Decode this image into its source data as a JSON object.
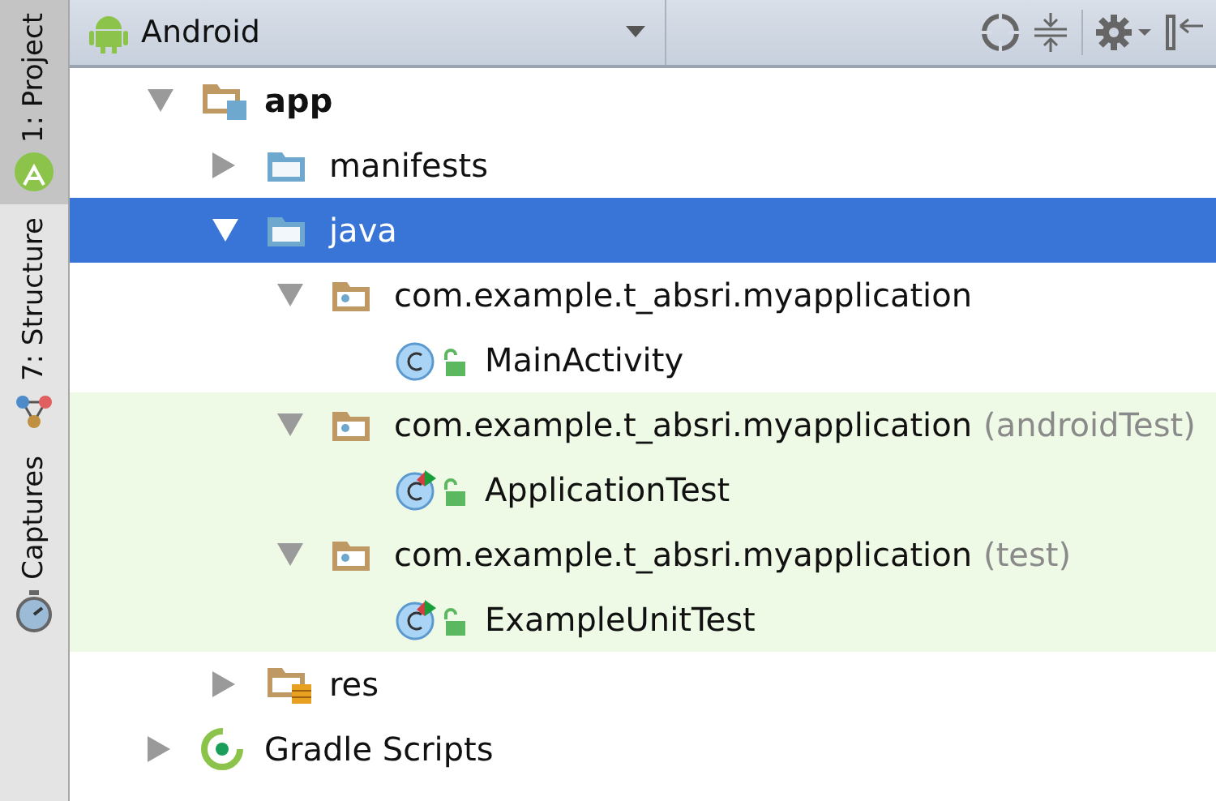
{
  "side_tabs": [
    {
      "label": "1: Project",
      "kind": "android",
      "selected": true
    },
    {
      "label": "7: Structure",
      "kind": "structure",
      "selected": false
    },
    {
      "label": "Captures",
      "kind": "captures",
      "selected": false
    }
  ],
  "view_selector": {
    "value": "Android"
  },
  "tree": [
    {
      "label": "app",
      "kind": "module",
      "expanded": true,
      "selected": false,
      "highlighted": false,
      "children": [
        {
          "label": "manifests",
          "kind": "folder",
          "expanded": false,
          "selected": false,
          "highlighted": false
        },
        {
          "label": "java",
          "kind": "folder",
          "expanded": true,
          "selected": true,
          "highlighted": false,
          "children": [
            {
              "label": "com.example.t_absri.myapplication",
              "kind": "package",
              "expanded": true,
              "selected": false,
              "highlighted": false,
              "children": [
                {
                  "label": "MainActivity",
                  "kind": "class",
                  "selected": false,
                  "highlighted": false
                }
              ]
            },
            {
              "label": "com.example.t_absri.myapplication",
              "suffix": "(androidTest)",
              "kind": "package",
              "expanded": true,
              "selected": false,
              "highlighted": true,
              "children": [
                {
                  "label": "ApplicationTest",
                  "kind": "test-class",
                  "selected": false,
                  "highlighted": true
                }
              ]
            },
            {
              "label": "com.example.t_absri.myapplication",
              "suffix": "(test)",
              "kind": "package",
              "expanded": true,
              "selected": false,
              "highlighted": true,
              "children": [
                {
                  "label": "ExampleUnitTest",
                  "kind": "test-class",
                  "selected": false,
                  "highlighted": true
                }
              ]
            }
          ]
        },
        {
          "label": "res",
          "kind": "res",
          "expanded": false,
          "selected": false,
          "highlighted": false
        }
      ]
    },
    {
      "label": "Gradle Scripts",
      "kind": "gradle",
      "expanded": false,
      "selected": false,
      "highlighted": false
    }
  ]
}
